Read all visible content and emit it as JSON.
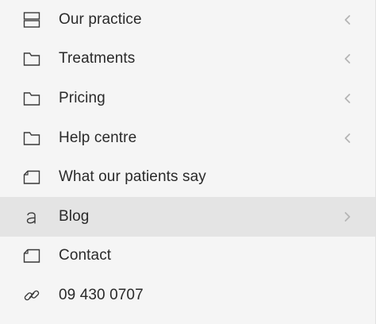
{
  "menu": {
    "items": [
      {
        "label": "Our practice",
        "icon": "layout-rows-icon",
        "chevron": "chevron-left-icon"
      },
      {
        "label": "Treatments",
        "icon": "folder-icon",
        "chevron": "chevron-left-icon"
      },
      {
        "label": "Pricing",
        "icon": "folder-icon",
        "chevron": "chevron-left-icon"
      },
      {
        "label": "Help centre",
        "icon": "folder-icon",
        "chevron": "chevron-left-icon"
      },
      {
        "label": "What our patients say",
        "icon": "page-icon"
      },
      {
        "label": "Blog",
        "icon": "letter-a-icon",
        "chevron": "chevron-right-icon",
        "active": true
      },
      {
        "label": "Contact",
        "icon": "page-icon"
      },
      {
        "label": "09 430 0707",
        "icon": "link-icon"
      }
    ]
  },
  "colors": {
    "background": "#f5f5f5",
    "active_background": "#e4e4e4",
    "text": "#2a2a2a",
    "icon": "#3a3a3a",
    "chevron": "#b5b5b5"
  }
}
